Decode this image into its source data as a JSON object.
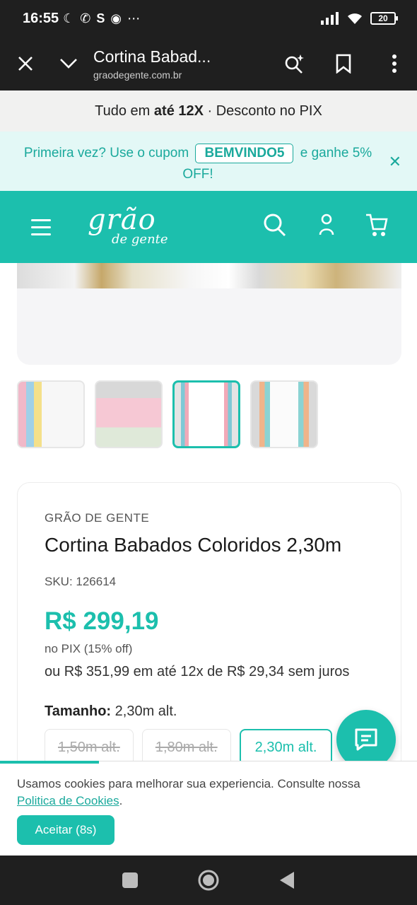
{
  "status_bar": {
    "time": "16:55",
    "battery": "20"
  },
  "browser": {
    "title": "Cortina Babad...",
    "url": "graodegente.com.br"
  },
  "promo": {
    "prefix": "Tudo em ",
    "bold_1": "até 12X",
    "suffix": " · Desconto no PIX"
  },
  "coupon": {
    "text_before": "Primeira vez? Use o cupom",
    "code": "BEMVINDO5",
    "text_after": "e ganhe 5% OFF!"
  },
  "logo": {
    "main": "grão",
    "sub": "de gente"
  },
  "product": {
    "brand": "GRÃO DE GENTE",
    "title": "Cortina Babados Coloridos 2,30m",
    "sku": "SKU: 126614",
    "price": "R$ 299,19",
    "pix_note": "no PIX (15% off)",
    "installments": "ou R$ 351,99 em até 12x de R$ 29,34 sem juros",
    "size_label": "Tamanho:",
    "size_value": "2,30m alt.",
    "sizes": [
      {
        "label": "1,50m alt."
      },
      {
        "label": "1,80m alt."
      },
      {
        "label": "2,30m alt."
      }
    ]
  },
  "cookie": {
    "text": "Usamos cookies para melhorar sua experiencia. Consulte nossa",
    "link": "Politica de Cookies",
    "end": ".",
    "accept": "Aceitar (8s)"
  },
  "colors": {
    "brand_teal": "#1cbfad",
    "dark_bar": "#1f1f1f"
  }
}
